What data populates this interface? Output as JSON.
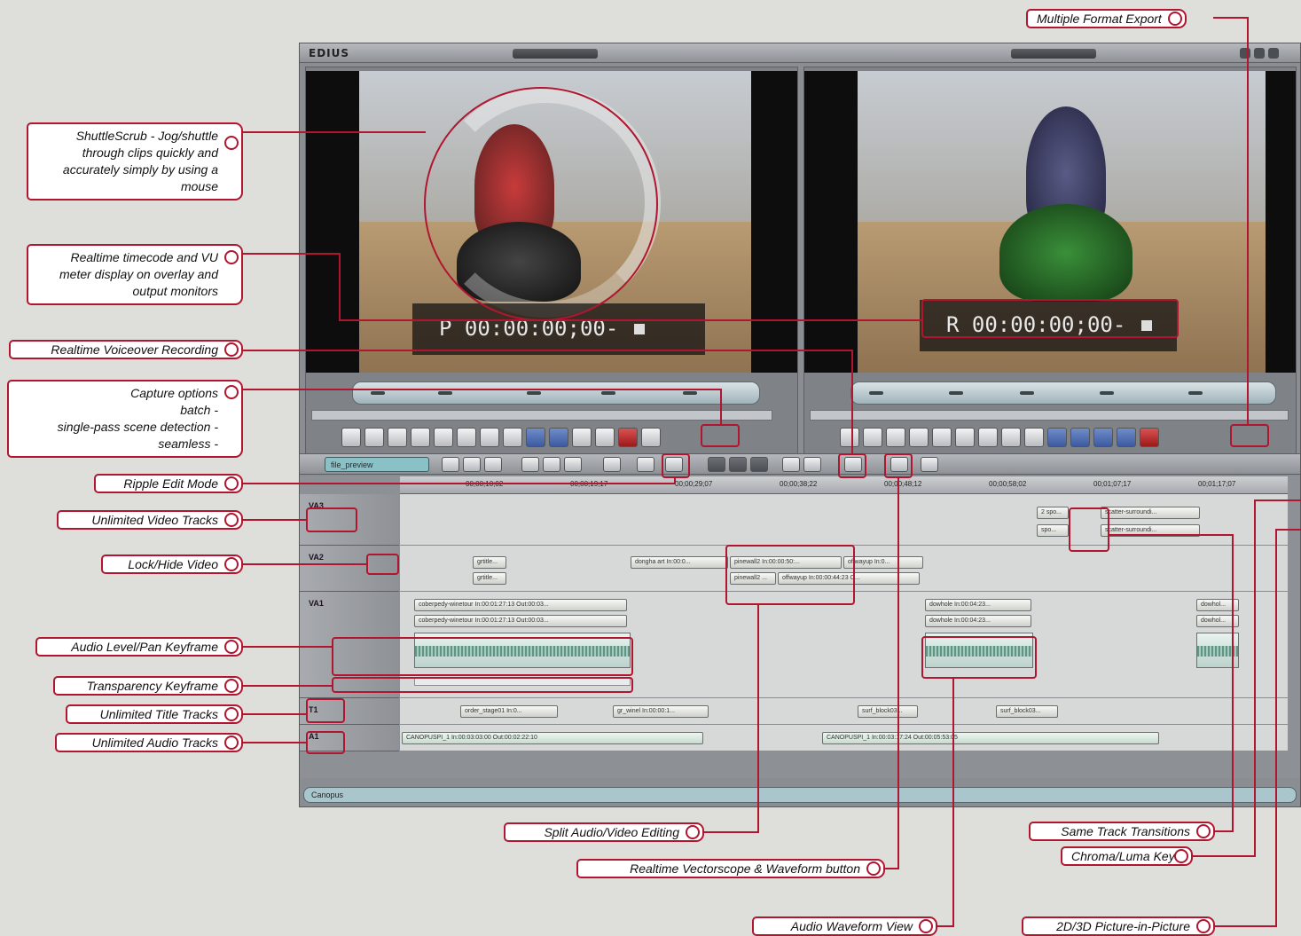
{
  "app": {
    "logo": "EDIUS",
    "player_timecode": "P 00:00:00;00-",
    "recorder_timecode": "R 00:00:00;00-",
    "sequence_name": "file_preview",
    "status_text": "Canopus"
  },
  "timeline": {
    "ruler_ticks": [
      "00;00;10;02",
      "00;00;19;17",
      "00;00;29;07",
      "00;00;38;22",
      "00;00;48;12",
      "00;00;58;02",
      "00;01;07;17",
      "00;01;17;07"
    ],
    "tracks": [
      {
        "label": "VA3",
        "clips": [
          "2 spo...",
          "spo...",
          "scatter-surroundi...",
          "scatter-surroundi..."
        ]
      },
      {
        "label": "VA2",
        "clips": [
          "grtitle...",
          "grtitle...",
          "dongha art In:00:0...",
          "pinewall2 In:00:00:50:...",
          "pinewall2 ...",
          "offwayup In:00:00:44:23 O...",
          "offwayup In:0..."
        ]
      },
      {
        "label": "VA1",
        "clips": [
          "coberpedy-winetour In:00:01:27:13 Out:00:03...",
          "coberpedy-winetour In:00:01:27:13 Out:00:03...",
          "dowhole In:00:04:23...",
          "dowhole In:00:04:23...",
          "dowhol...",
          "dowhol..."
        ]
      },
      {
        "label": "T1",
        "clips": [
          "order_stage01 In:0...",
          "gr_winel In:00:00:1...",
          "surf_block03...",
          "surf_block03..."
        ]
      },
      {
        "label": "A1",
        "clips": [
          "CANOPUSPI_1 In:00:03:03:00 Out:00:02:22:10",
          "CANOPUSPI_1 In:00:03:17:24 Out:00:05:53:05"
        ]
      }
    ]
  },
  "callouts": {
    "multi_format_export": "Multiple Format Export",
    "shuttle_scrub": "ShuttleScrub - Jog/shuttle through clips quickly and accurately  simply by using a mouse",
    "timecode_vu": "Realtime timecode and VU meter display on overlay and output monitors",
    "voiceover": "Realtime Voiceover Recording",
    "capture_1": "Capture options",
    "capture_2": "batch -",
    "capture_3": "single-pass scene detection -",
    "capture_4": "seamless -",
    "ripple_edit": "Ripple Edit Mode",
    "unlimited_video": "Unlimited Video Tracks",
    "lock_hide": "Lock/Hide Video",
    "audio_level": "Audio Level/Pan Keyframe",
    "transparency": "Transparency Keyframe",
    "unlimited_title": "Unlimited Title Tracks",
    "unlimited_audio": "Unlimited Audio Tracks",
    "split_av": "Split Audio/Video Editing",
    "vectorscope": "Realtime Vectorscope & Waveform button",
    "waveform_view": "Audio Waveform View",
    "same_track": "Same Track Transitions",
    "chroma_luma": "Chroma/Luma Key",
    "pip": "2D/3D Picture-in-Picture"
  },
  "colors": {
    "accent": "#b01630",
    "background": "#dededb",
    "window": "#8a8d92"
  }
}
